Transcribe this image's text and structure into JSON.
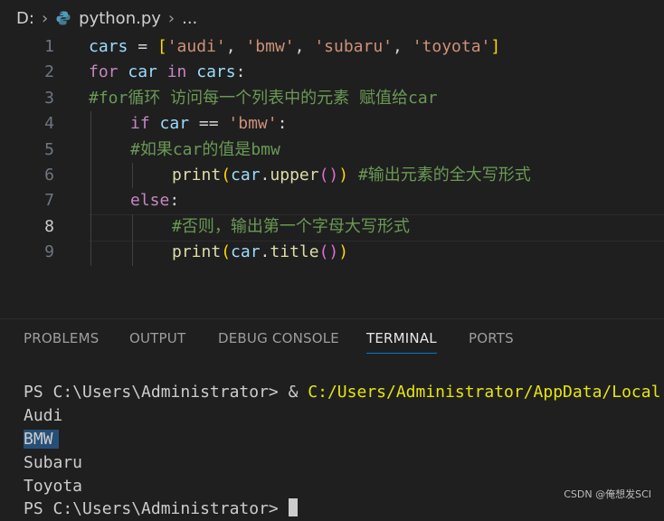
{
  "breadcrumb": {
    "drive": "D:",
    "file": "python.py",
    "ellipsis": "..."
  },
  "editor": {
    "current_line": 8,
    "lines": [
      {
        "n": "1",
        "indent": 0,
        "tokens": [
          [
            "cars",
            "var"
          ],
          [
            " = ",
            "op"
          ],
          [
            "[",
            "br1"
          ],
          [
            "'audi'",
            "str"
          ],
          [
            ", ",
            "op"
          ],
          [
            "'bmw'",
            "str"
          ],
          [
            ", ",
            "op"
          ],
          [
            "'subaru'",
            "str"
          ],
          [
            ", ",
            "op"
          ],
          [
            "'toyota'",
            "str"
          ],
          [
            "]",
            "br1"
          ]
        ]
      },
      {
        "n": "2",
        "indent": 0,
        "tokens": [
          [
            "for",
            "kw"
          ],
          [
            " car ",
            "var"
          ],
          [
            "in",
            "kw"
          ],
          [
            " cars",
            "var"
          ],
          [
            ":",
            "op"
          ]
        ]
      },
      {
        "n": "3",
        "indent": 0,
        "tokens": [
          [
            "#for循环 访问每一个列表中的元素 赋值给car",
            "cm"
          ]
        ]
      },
      {
        "n": "4",
        "indent": 1,
        "tokens": [
          [
            "if",
            "kw"
          ],
          [
            " car ",
            "var"
          ],
          [
            "== ",
            "op"
          ],
          [
            "'bmw'",
            "str"
          ],
          [
            ":",
            "op"
          ]
        ]
      },
      {
        "n": "5",
        "indent": 1,
        "tokens": [
          [
            "#如果car的值是bmw",
            "cm"
          ]
        ]
      },
      {
        "n": "6",
        "indent": 2,
        "tokens": [
          [
            "print",
            "fn"
          ],
          [
            "(",
            "br1"
          ],
          [
            "car",
            "var"
          ],
          [
            ".",
            "op"
          ],
          [
            "upper",
            "fn"
          ],
          [
            "()",
            "br2"
          ],
          [
            ")",
            "br1"
          ],
          [
            " ",
            "op"
          ],
          [
            "#输出元素的全大写形式",
            "cm"
          ]
        ]
      },
      {
        "n": "7",
        "indent": 1,
        "tokens": [
          [
            "else",
            "kw"
          ],
          [
            ":",
            "op"
          ]
        ]
      },
      {
        "n": "8",
        "indent": 2,
        "tokens": [
          [
            "#否则，输出第一个字母大写形式",
            "cm"
          ]
        ]
      },
      {
        "n": "9",
        "indent": 2,
        "tokens": [
          [
            "print",
            "fn"
          ],
          [
            "(",
            "br1"
          ],
          [
            "car",
            "var"
          ],
          [
            ".",
            "op"
          ],
          [
            "title",
            "fn"
          ],
          [
            "()",
            "br2"
          ],
          [
            ")",
            "br1"
          ]
        ]
      }
    ]
  },
  "panel": {
    "tabs": [
      {
        "label": "PROBLEMS",
        "active": false
      },
      {
        "label": "OUTPUT",
        "active": false
      },
      {
        "label": "DEBUG CONSOLE",
        "active": false
      },
      {
        "label": "TERMINAL",
        "active": true
      },
      {
        "label": "PORTS",
        "active": false
      }
    ]
  },
  "terminal": {
    "prompt": "PS C:\\Users\\Administrator> ",
    "command_amp": "& ",
    "command_path": "C:/Users/Administrator/AppData/Local",
    "output": [
      "Audi",
      "BMW",
      "Subaru",
      "Toyota"
    ],
    "selected_output": "BMW",
    "last_prompt": "PS C:\\Users\\Administrator> "
  },
  "watermark": "CSDN @俺想发SCI",
  "colors": {
    "background": "#1f1f1f",
    "keyword": "#c586c0",
    "string": "#ce9178",
    "comment": "#6a9955",
    "function": "#dcdcaa",
    "variable": "#9cdcfe",
    "accent": "#0078d4",
    "terminal_path": "#e5e510",
    "selection": "#264f78"
  }
}
